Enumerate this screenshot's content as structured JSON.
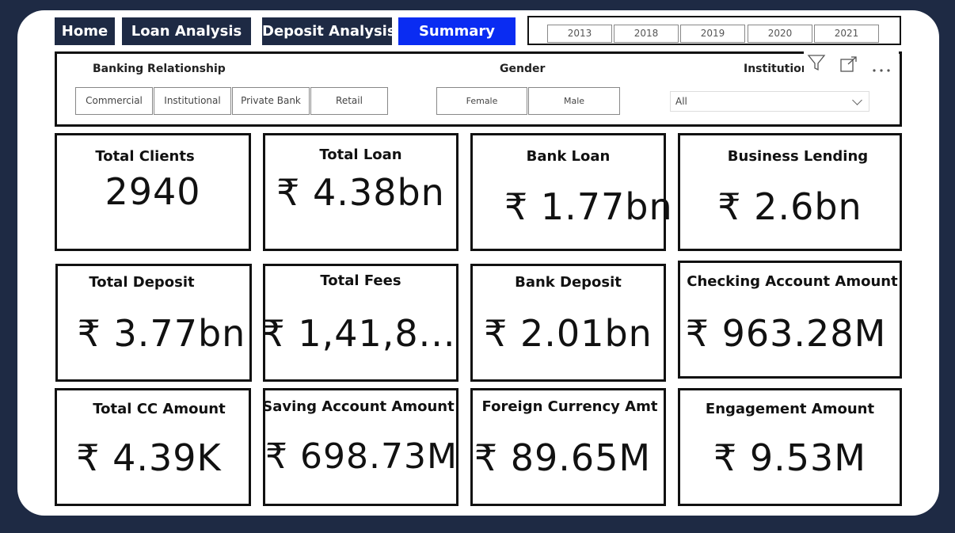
{
  "nav": {
    "home": "Home",
    "loan_analysis": "Loan Analysis",
    "deposit_analysis": "Deposit Analysis",
    "summary": "Summary"
  },
  "years": [
    "2013",
    "2018",
    "2019",
    "2020",
    "2021"
  ],
  "filters": {
    "banking_relationship": {
      "title": "Banking Relationship",
      "options": [
        "Commercial",
        "Institutional",
        "Private Bank",
        "Retail"
      ]
    },
    "gender": {
      "title": "Gender",
      "options": [
        "Female",
        "Male"
      ]
    },
    "institution": {
      "title": "Institution",
      "selected": "All"
    }
  },
  "icons": [
    "filter-icon",
    "focus-mode-icon",
    "more-options-icon"
  ],
  "cards": [
    {
      "title": "Total Clients",
      "value": "2940"
    },
    {
      "title": "Total Loan",
      "value": "₹ 4.38bn"
    },
    {
      "title": "Bank Loan",
      "value": "₹ 1.77bn"
    },
    {
      "title": "Business Lending",
      "value": "₹ 2.6bn"
    },
    {
      "title": "Total Deposit",
      "value": "₹ 3.77bn"
    },
    {
      "title": "Total Fees",
      "value": "₹ 1,41,8..."
    },
    {
      "title": "Bank Deposit",
      "value": "₹ 2.01bn"
    },
    {
      "title": "Checking Account Amount",
      "value": "₹ 963.28M"
    },
    {
      "title": "Total CC Amount",
      "value": "₹ 4.39K"
    },
    {
      "title": "Saving Account Amount",
      "value": "₹ 698.73M"
    },
    {
      "title": "Foreign Currency Amt",
      "value": "₹ 89.65M"
    },
    {
      "title": "Engagement Amount",
      "value": "₹ 9.53M"
    }
  ],
  "colors": {
    "nav_bg": "#1e2a44",
    "nav_active": "#0a2cf2",
    "page_bg": "#1e2a44",
    "canvas_bg": "#ffffff"
  }
}
